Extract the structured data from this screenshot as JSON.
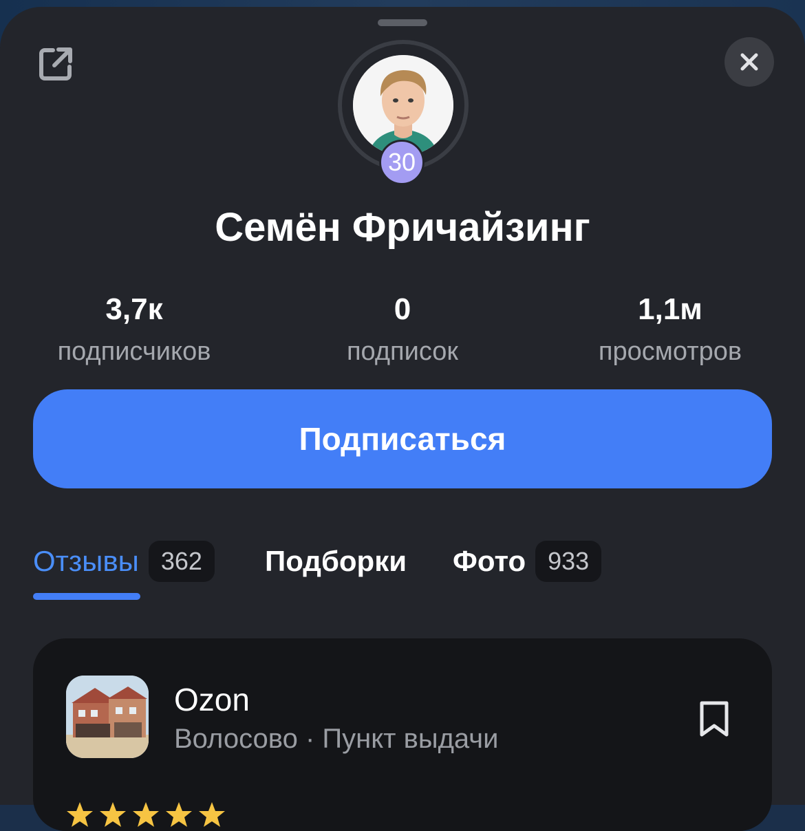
{
  "profile": {
    "name": "Семён Фричайзинг",
    "level": "30"
  },
  "stats": [
    {
      "value": "3,7к",
      "label": "подписчиков"
    },
    {
      "value": "0",
      "label": "подписок"
    },
    {
      "value": "1,1м",
      "label": "просмотров"
    }
  ],
  "actions": {
    "subscribe_label": "Подписаться"
  },
  "tabs": [
    {
      "label": "Отзывы",
      "count": "362",
      "active": true
    },
    {
      "label": "Подборки",
      "active": false
    },
    {
      "label": "Фото",
      "count": "933",
      "active": false
    }
  ],
  "review": {
    "place_name": "Ozon",
    "place_meta": "Волосово · Пункт выдачи",
    "rating": 5
  },
  "icons": {
    "share": "external-link-icon",
    "close": "close-icon",
    "bookmark": "bookmark-icon",
    "star": "star-icon"
  },
  "colors": {
    "accent": "#437ef7",
    "level_badge": "#a39cf2",
    "sheet_bg": "#23252b",
    "card_bg": "#141518"
  }
}
